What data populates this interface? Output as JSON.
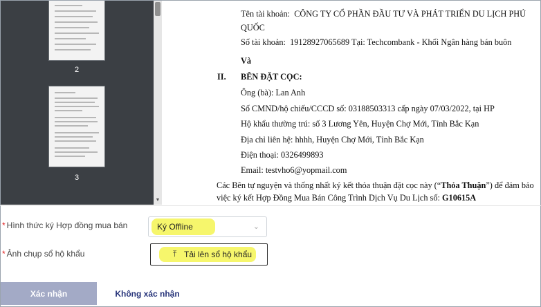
{
  "viewer": {
    "thumbnails": [
      {
        "page": "2"
      },
      {
        "page": "3"
      }
    ]
  },
  "document": {
    "account_name_label": "Tên tài khoản:",
    "account_name_value_1": "CÔNG TY CỔ PHẦN ĐẦU TƯ VÀ PHÁT TRIỂN DU LỊCH PHÚ",
    "account_name_value_2": "QUỐC",
    "account_number_label": "Số tài khoản:",
    "account_number_value": "19128927065689 Tại: Techcombank - Khối Ngân hàng bán buôn",
    "and_word": "Và",
    "section_num": "II.",
    "section_title": "BÊN ĐẶT CỌC:",
    "name_line": "Ông (bà): Lan Anh",
    "id_line": "Số CMND/hộ chiếu/CCCD số: 03188503313 cấp ngày 07/03/2022, tại HP",
    "household_line": "Hộ khẩu thường trú: số 3 Lương Yên, Huyện Chợ Mới, Tỉnh Bắc Kạn",
    "contact_line": "Địa chỉ liên hệ: hhhh, Huyện Chợ Mới, Tỉnh Bắc Kạn",
    "phone_line": "Điện thoại: 0326499893",
    "email_line": "Email: testvho6@yopmail.com",
    "para_1a": "Các Bên tự nguyện và thống nhất ký kết thỏa thuận đặt cọc này (“",
    "para_1b": "Thỏa Thuận",
    "para_1c": "”) để đảm bảo",
    "para_2a": "việc  ký  kết  Hợp  Đồng  Mua  Bán  Công  Trình  Dịch  Vụ  Du    Lịch  số:  ",
    "para_2b": "G10615A"
  },
  "form": {
    "contract_type_label": "Hình thức ký Hợp đồng mua bán",
    "contract_type_value": "Ký Offline",
    "household_photo_label": "Ảnh chụp sổ hộ khẩu",
    "upload_button_label": "Tải lên sổ hộ khẩu",
    "required_mark": "*"
  },
  "actions": {
    "confirm_label": "Xác nhận",
    "decline_label": "Không xác nhận"
  },
  "colors": {
    "highlight": "#f6f66c",
    "confirm_bg": "#a3aac6",
    "decline_text": "#27347a",
    "required": "#e02020"
  }
}
